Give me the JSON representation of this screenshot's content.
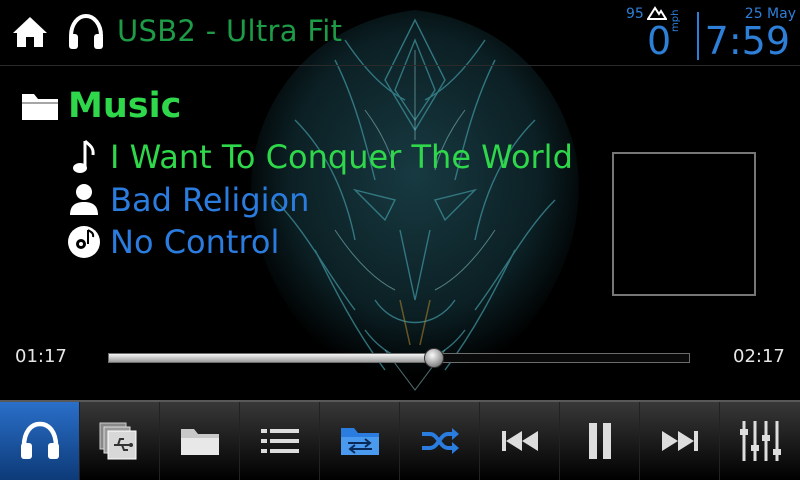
{
  "header": {
    "home_icon": "home-icon",
    "source_icon": "headphones-icon",
    "source_title": "USB2 - Ultra Fit",
    "altitude": "95",
    "speed": "0",
    "speed_unit": "mph",
    "date": "25 May",
    "time": "7:59"
  },
  "now_playing": {
    "folder_icon": "folder-icon",
    "folder": "Music",
    "title_icon": "music-note-icon",
    "title": "I Want To Conquer The World",
    "artist_icon": "person-icon",
    "artist": "Bad Religion",
    "album_icon": "disc-icon",
    "album": "No Control"
  },
  "progress": {
    "elapsed": "01:17",
    "total": "02:17",
    "fraction": 0.56
  },
  "bottom_bar": [
    {
      "icon": "headphones-icon",
      "active": true
    },
    {
      "icon": "usb-devices-icon",
      "active": false
    },
    {
      "icon": "folder-icon",
      "active": false
    },
    {
      "icon": "list-icon",
      "active": false
    },
    {
      "icon": "folder-repeat-icon",
      "active": false
    },
    {
      "icon": "shuffle-icon",
      "active": false
    },
    {
      "icon": "previous-track-icon",
      "active": false
    },
    {
      "icon": "pause-icon",
      "active": false
    },
    {
      "icon": "next-track-icon",
      "active": false
    },
    {
      "icon": "equalizer-icon",
      "active": false
    }
  ],
  "colors": {
    "accent_blue": "#2e7fd8",
    "title_green": "#2fd84a",
    "source_green": "#1d9b46"
  }
}
